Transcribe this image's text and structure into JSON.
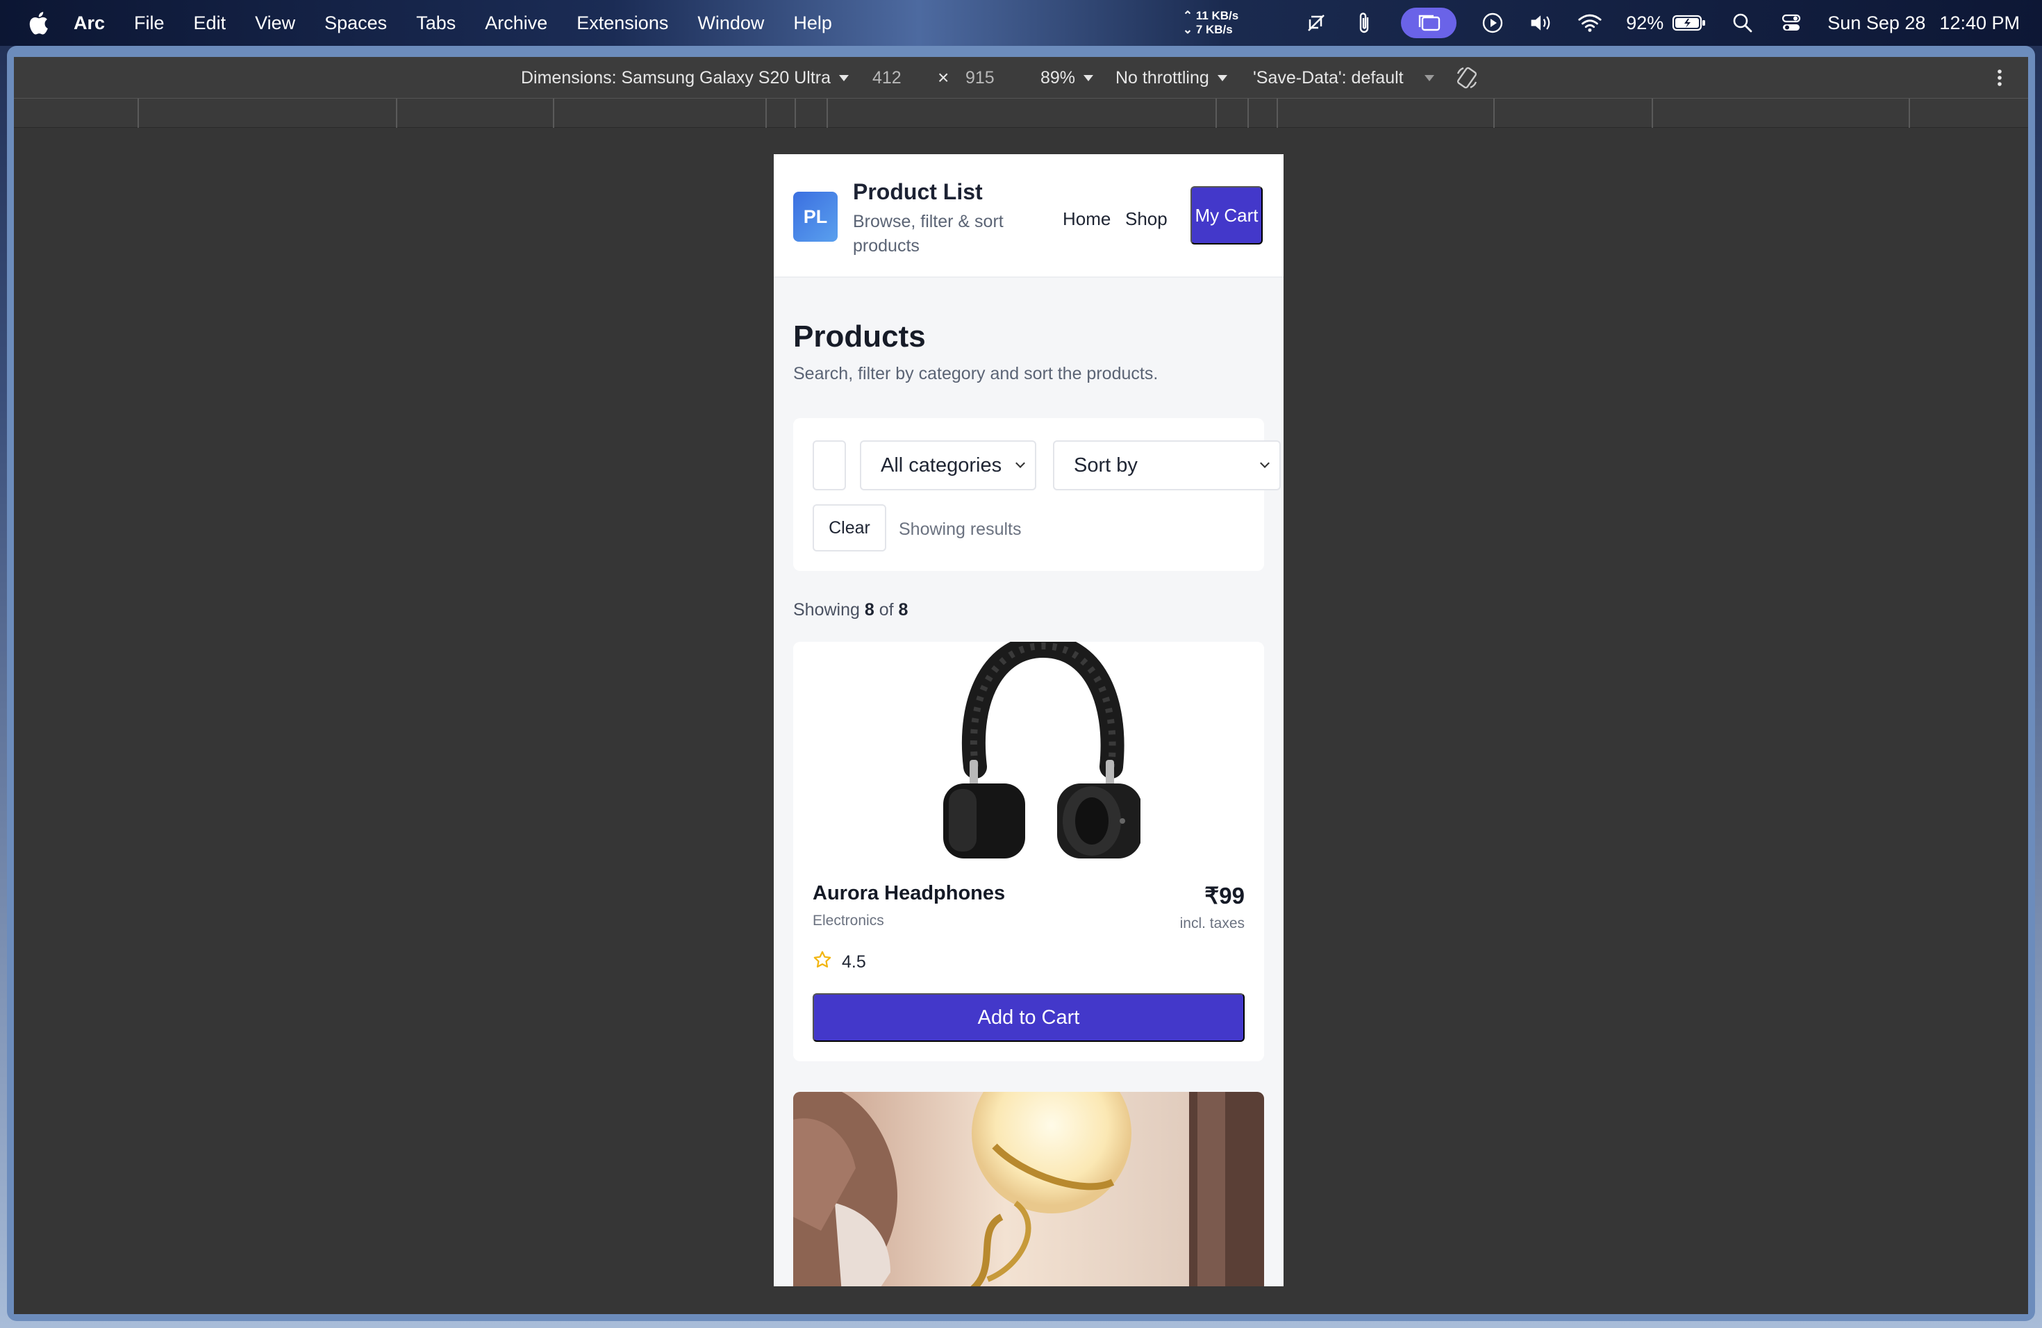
{
  "menubar": {
    "app_name": "Arc",
    "items": [
      "File",
      "Edit",
      "View",
      "Spaces",
      "Tabs",
      "Archive",
      "Extensions",
      "Window",
      "Help"
    ],
    "net_up": "11 KB/s",
    "net_down": "7 KB/s",
    "battery": "92%",
    "date": "Sun Sep 28",
    "time": "12:40 PM"
  },
  "devtools": {
    "dimensions_label": "Dimensions: Samsung Galaxy S20 Ultra",
    "width": "412",
    "times": "×",
    "height": "915",
    "zoom": "89%",
    "throttling": "No throttling",
    "save_data": "'Save-Data': default"
  },
  "site": {
    "logo": "PL",
    "title": "Product List",
    "subtitle": "Browse, filter & sort products",
    "nav": [
      "Home",
      "Shop"
    ],
    "cart_button": "My Cart"
  },
  "page": {
    "title": "Products",
    "subtitle": "Search, filter by category and sort the products."
  },
  "filters": {
    "search_value": "",
    "category_selected": "All categories",
    "sort_selected": "Sort by",
    "clear_label": "Clear",
    "status": "Showing results"
  },
  "results": {
    "prefix": "Showing",
    "shown": "8",
    "of": "of",
    "total": "8"
  },
  "products": [
    {
      "name": "Aurora Headphones",
      "category": "Electronics",
      "price": "₹99",
      "tax_note": "incl. taxes",
      "rating": "4.5",
      "cta": "Add to Cart"
    }
  ],
  "colors": {
    "accent": "#4338ca",
    "star": "#f2b50f",
    "viewport_bg": "#363636",
    "devtools_bg": "#3c3c3c"
  }
}
